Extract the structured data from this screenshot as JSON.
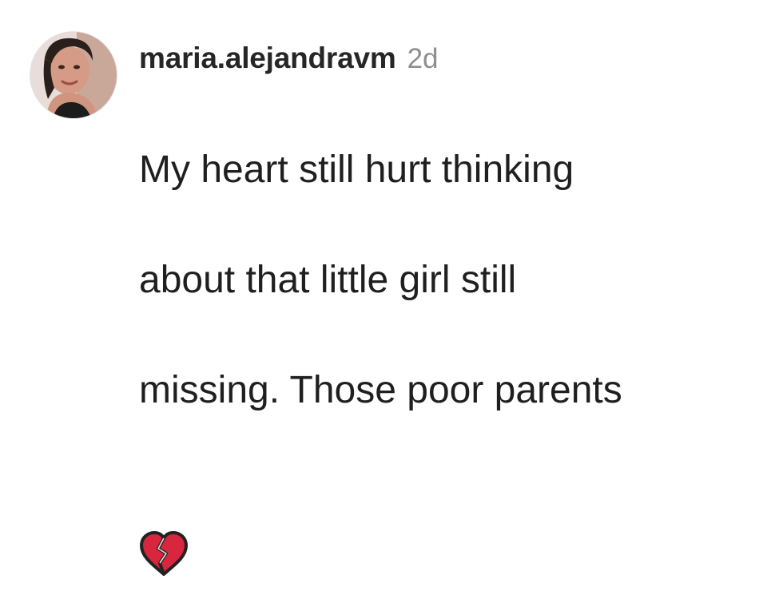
{
  "comment": {
    "username": "maria.alejandravm",
    "timestamp": "2d",
    "lines": [
      "My heart still hurt thinking",
      "about that little girl still",
      "missing. Those poor parents"
    ],
    "emoji": "broken-heart-icon"
  },
  "colors": {
    "username": "#262626",
    "timestamp": "#8e8e8e",
    "text": "#1f1f1f",
    "heart": "#d7263d"
  }
}
